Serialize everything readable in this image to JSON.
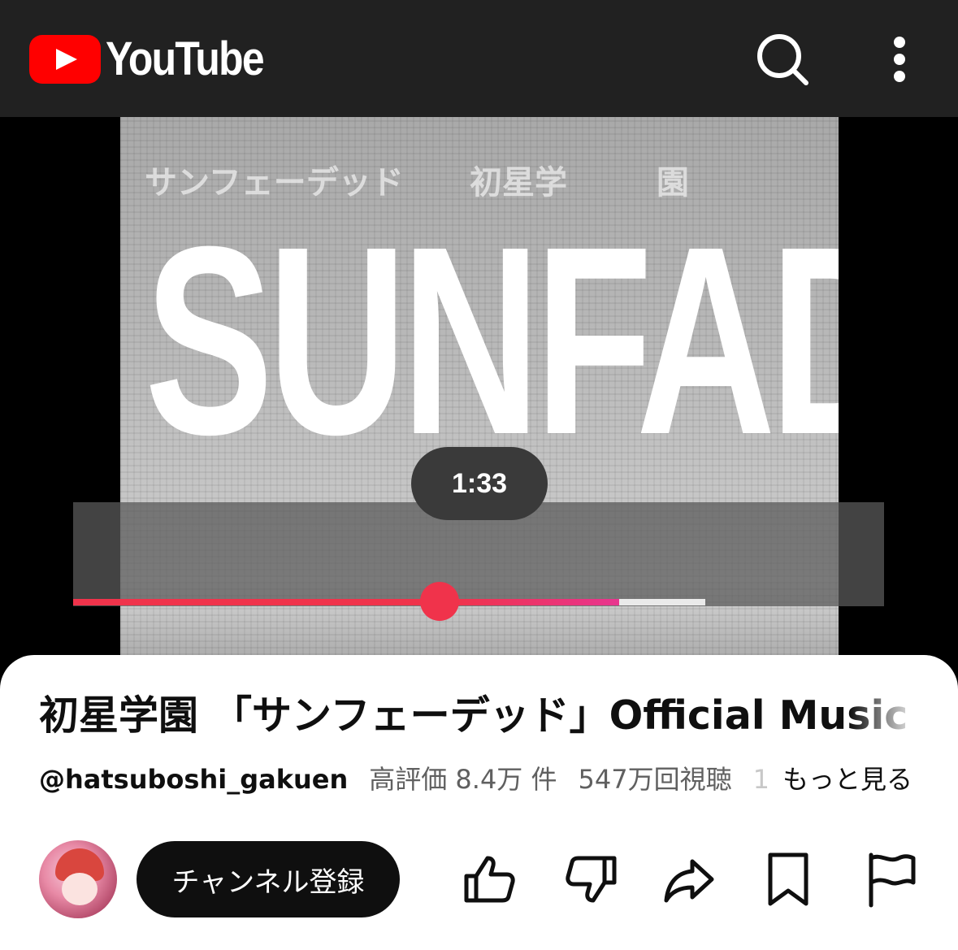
{
  "app": {
    "logo_text": "YouTube",
    "icons": [
      "search-icon",
      "more-vert-icon"
    ]
  },
  "video": {
    "frame_text_top": [
      "サンフェーデッド",
      "初星学",
      "園"
    ],
    "frame_text_big": "SUNFAD",
    "scrub_time": "1:33",
    "progress_fraction": 0.452,
    "buffered_fraction": 0.78,
    "colors": {
      "progress": "#f0334b",
      "progress_end": "#e8358f"
    }
  },
  "info": {
    "title": "初星学園 「サンフェーデッド」Official Music Video",
    "channel_handle": "@hatsuboshi_gakuen",
    "likes": "高評価 8.4万 件",
    "views": "547万回視聴",
    "truncated": "1",
    "more_label": "もっと見る"
  },
  "actions": {
    "subscribe_label": "チャンネル登録",
    "icons": [
      "like-icon",
      "dislike-icon",
      "share-icon",
      "save-icon",
      "report-icon"
    ]
  }
}
